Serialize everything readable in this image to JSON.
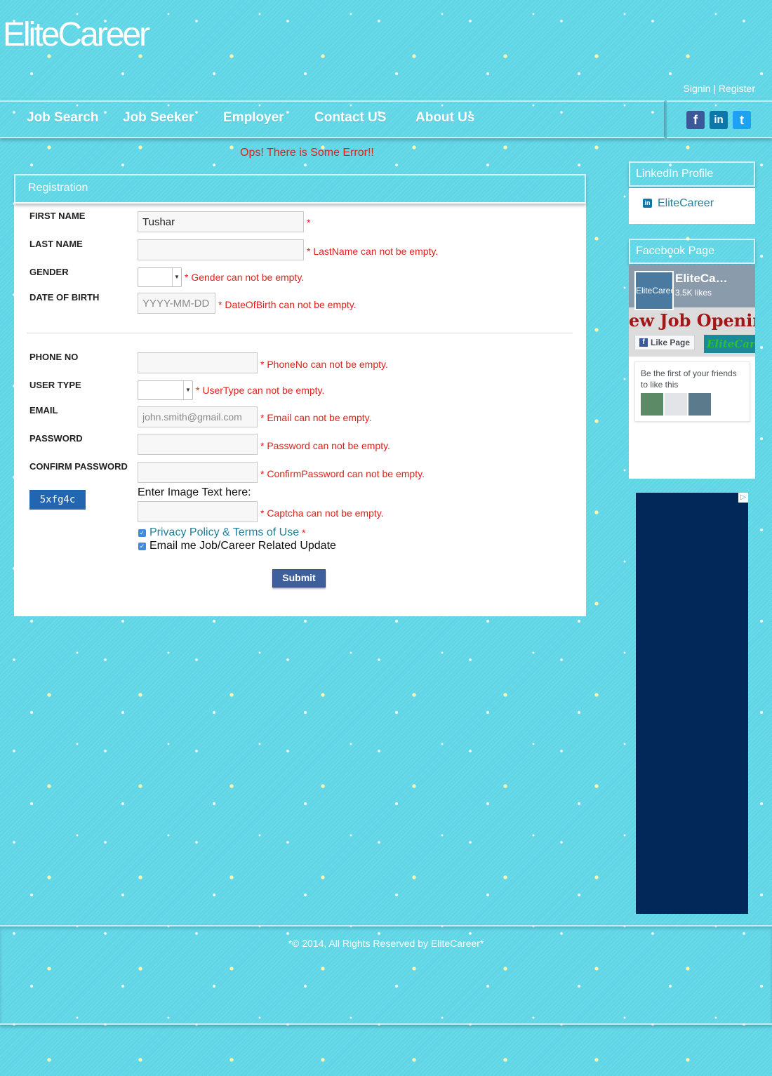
{
  "brand": {
    "logo": "EliteCareer"
  },
  "auth": {
    "signin": "Signin",
    "separator": "|",
    "register": "Register"
  },
  "nav": [
    "Job Search",
    "Job Seeker",
    "Employer",
    "Contact US",
    "About Us"
  ],
  "social": {
    "facebook_glyph": "f",
    "linkedin_glyph": "in",
    "twitter_glyph": "t"
  },
  "error_banner": "Ops! There is Some Error!!",
  "form": {
    "title": "Registration",
    "first_name": {
      "label": "FIRST NAME",
      "value": "Tushar",
      "star": "*"
    },
    "last_name": {
      "label": "LAST NAME",
      "error": "* LastName can not be empty."
    },
    "gender": {
      "label": "GENDER",
      "error": "* Gender can not be empty."
    },
    "dob": {
      "label": "DATE OF BIRTH",
      "placeholder": "YYYY-MM-DD",
      "error": "* DateOfBirth can not be empty."
    },
    "phone": {
      "label": "PHONE NO",
      "error": "* PhoneNo can not be empty."
    },
    "user_type": {
      "label": "USER TYPE",
      "error": "* UserType can not be empty."
    },
    "email": {
      "label": "EMAIL",
      "placeholder": "john.smith@gmail.com",
      "error": "* Email can not be empty."
    },
    "password": {
      "label": "PASSWORD",
      "error": "* Password can not be empty."
    },
    "confirm_password": {
      "label": "CONFIRM PASSWORD",
      "error": "* ConfirmPassword can not be empty."
    },
    "captcha": {
      "image_text": "5xfg4c",
      "prompt": "Enter Image Text here:",
      "error": "* Captcha can not be empty."
    },
    "privacy": {
      "label": "Privacy Policy & Terms of Use",
      "star": "*",
      "checked": true
    },
    "updates": {
      "label": "Email me Job/Career Related Update",
      "checked": true
    },
    "submit": "Submit"
  },
  "sidebar": {
    "linkedin": {
      "title": "LinkedIn Profile",
      "link": "EliteCareer"
    },
    "facebook": {
      "title": "Facebook Page",
      "page_name": "EliteCa…",
      "likes": "3.5K likes",
      "banner": "ew Job Openin",
      "logo_text": "EliteCareer",
      "like_button": "Like Page",
      "cover_brand": "EliteCar",
      "friends_text": "Be the first of your friends to like this"
    }
  },
  "ad": {
    "badge": "▷"
  },
  "footer": {
    "text": "*© 2014, All Rights Reserved by EliteCareer*"
  },
  "colors": {
    "background": "#5fd6e6",
    "error": "#e0201b",
    "link": "#1f7f9a",
    "ad": "#02285a",
    "submit": "#3f5f9c"
  }
}
